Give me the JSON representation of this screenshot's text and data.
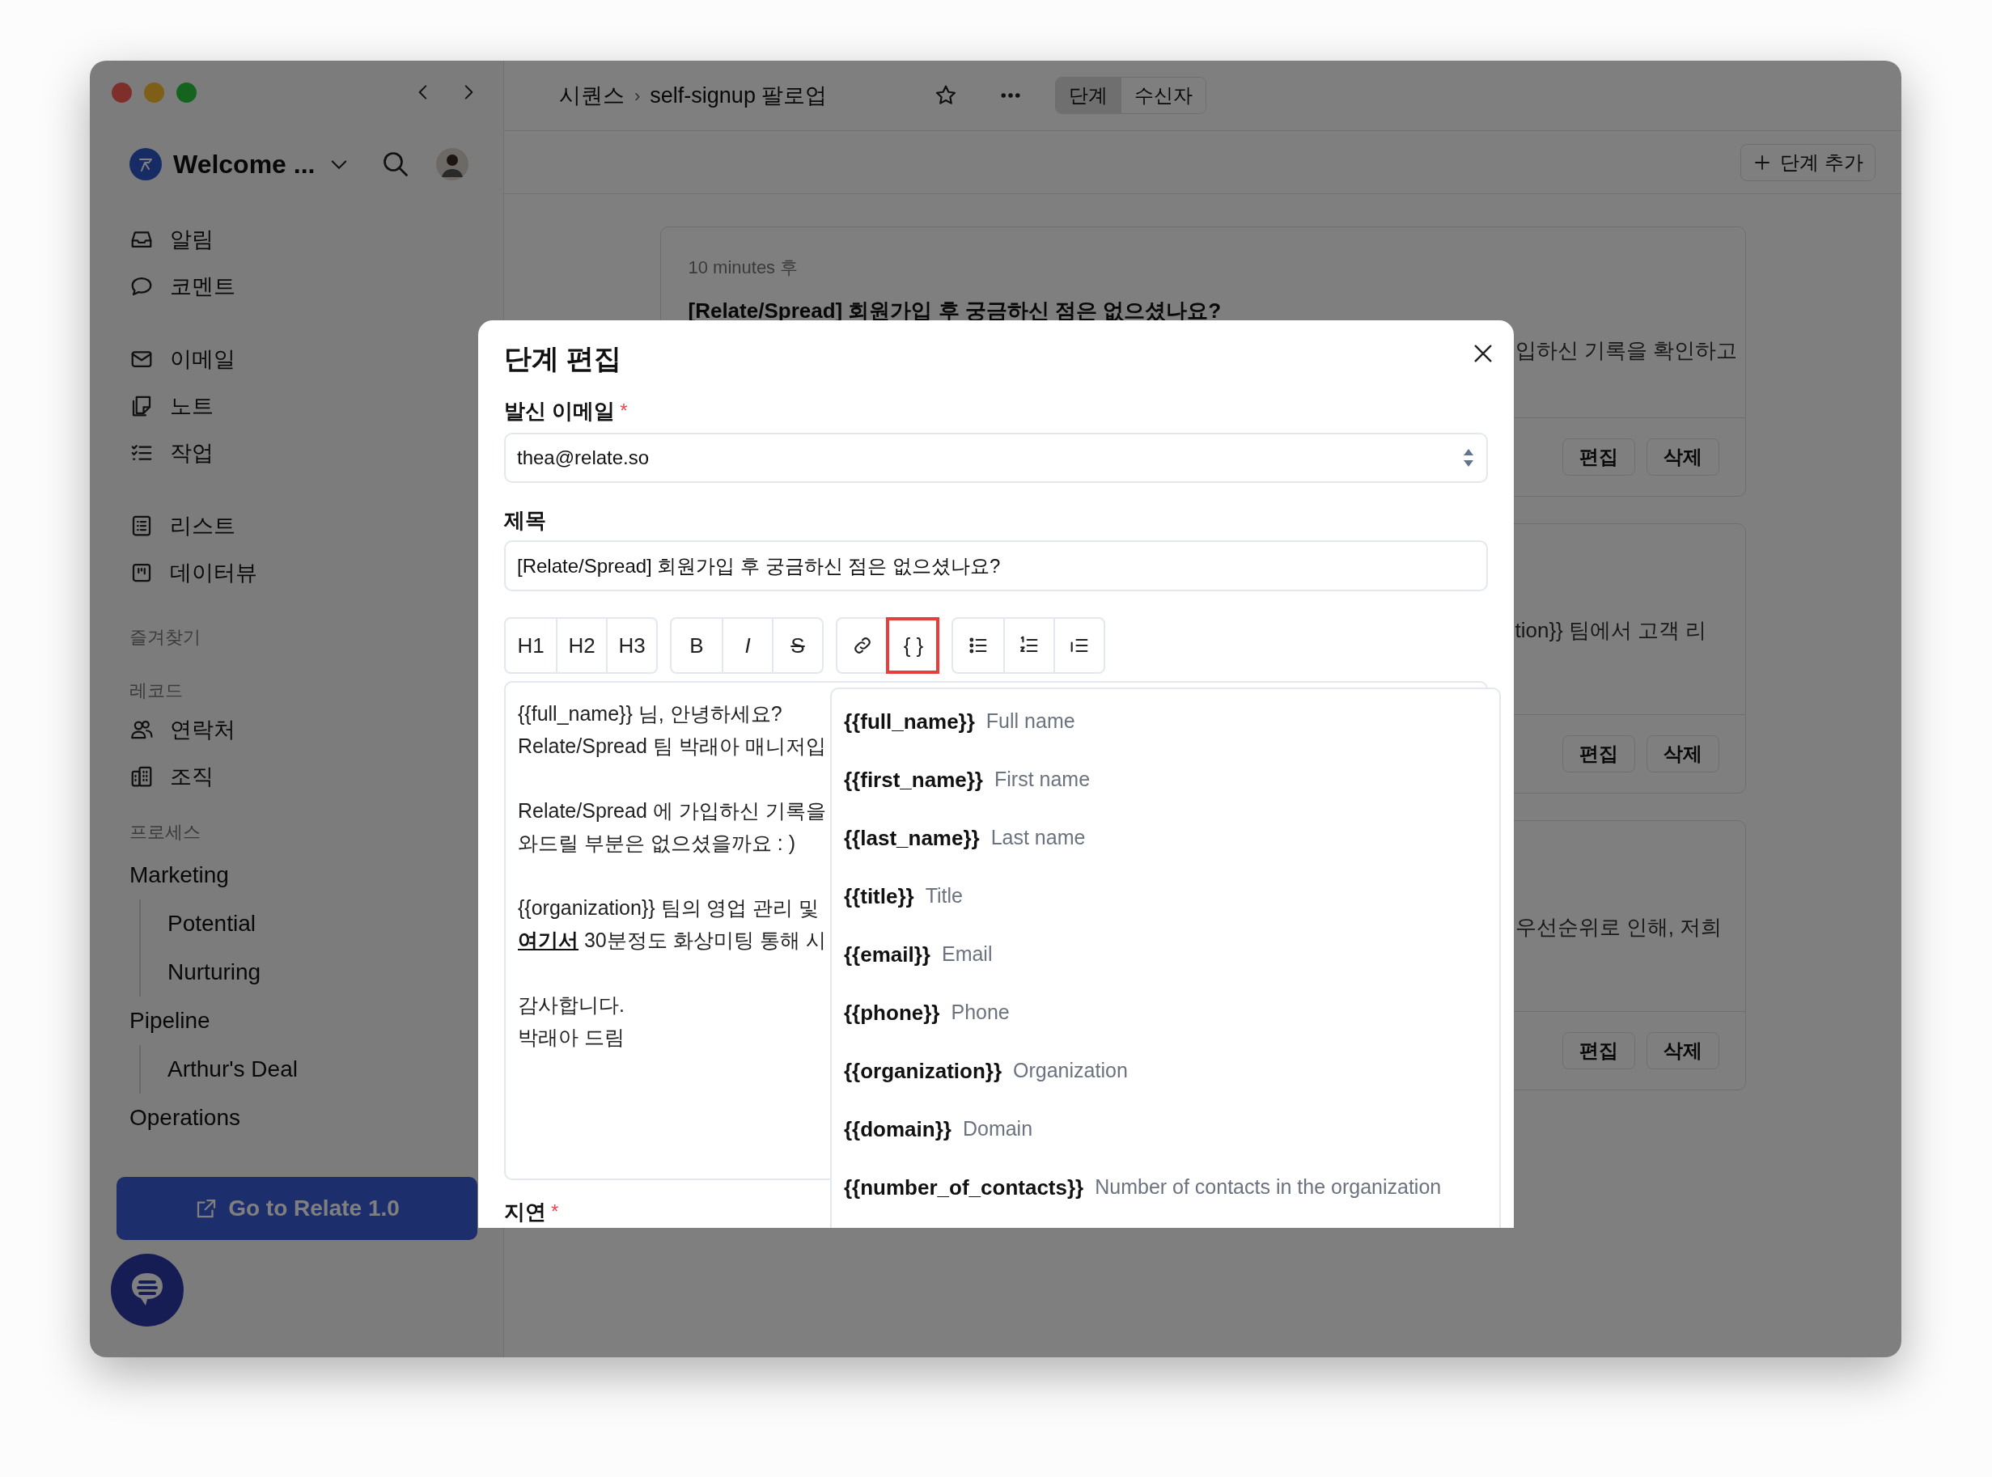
{
  "workspace": {
    "name": "Welcome ..."
  },
  "sidebar": {
    "nav_groups": [
      [
        {
          "label": "알림",
          "kind": "inbox"
        },
        {
          "label": "코멘트",
          "kind": "comment"
        }
      ],
      [
        {
          "label": "이메일",
          "kind": "mail"
        },
        {
          "label": "노트",
          "kind": "note"
        },
        {
          "label": "작업",
          "kind": "tasks"
        }
      ],
      [
        {
          "label": "리스트",
          "kind": "list"
        },
        {
          "label": "데이터뷰",
          "kind": "board"
        }
      ]
    ],
    "favorites": {
      "title": "즐겨찾기"
    },
    "records": {
      "title": "레코드",
      "items": [
        {
          "label": "연락처",
          "kind": "people"
        },
        {
          "label": "조직",
          "kind": "building"
        }
      ]
    },
    "processes": {
      "title": "프로세스",
      "items": [
        {
          "label": "Marketing",
          "children": [
            {
              "label": "Potential"
            },
            {
              "label": "Nurturing"
            }
          ]
        },
        {
          "label": "Pipeline",
          "children": [
            {
              "label": "Arthur's Deal"
            }
          ]
        },
        {
          "label": "Operations"
        }
      ]
    },
    "cta": "Go to Relate 1.0"
  },
  "header": {
    "breadcrumb": [
      "시퀀스",
      "self-signup 팔로업"
    ],
    "separator": "›",
    "tabs": [
      {
        "label": "단계",
        "selected": true
      },
      {
        "label": "수신자",
        "selected": false
      }
    ],
    "add_button": "단계 추가"
  },
  "cards": [
    {
      "delay": "10 minutes 후",
      "title": "[Relate/Spread] 회원가입 후 궁금하신 점은 없으셨나요?",
      "snippet": "입하신 기록을 확인하고",
      "buttons": [
        "편집",
        "삭제"
      ]
    },
    {
      "snippet": "tion}} 팀에서 고객 리",
      "buttons": [
        "편집",
        "삭제"
      ]
    },
    {
      "snippet": "우선순위로 인해, 저희",
      "buttons": [
        "편집",
        "삭제"
      ]
    }
  ],
  "modal": {
    "title": "단계 편집",
    "sender": {
      "label": "발신 이메일",
      "required_mark": "*",
      "value": "thea@relate.so"
    },
    "subject": {
      "label": "제목",
      "value": "[Relate/Spread] 회원가입 후 궁금하신 점은 없으셨나요?"
    },
    "toolbar": [
      [
        {
          "kind": "text",
          "label": "H1",
          "highlighted": false
        },
        {
          "kind": "text",
          "label": "H2",
          "highlighted": false
        },
        {
          "kind": "text",
          "label": "H3",
          "highlighted": false
        }
      ],
      [
        {
          "kind": "bold",
          "label": "B",
          "highlighted": false
        },
        {
          "kind": "italic",
          "label": "I",
          "highlighted": false
        },
        {
          "kind": "strike",
          "label": "S",
          "highlighted": false
        }
      ],
      [
        {
          "kind": "link",
          "highlighted": false
        },
        {
          "kind": "text",
          "label": "{ }",
          "highlighted": true
        }
      ],
      [
        {
          "kind": "bullets",
          "highlighted": false
        },
        {
          "kind": "numbers",
          "highlighted": false
        },
        {
          "kind": "indent",
          "highlighted": false
        }
      ]
    ],
    "body": [
      {
        "lines": [
          {
            "text": "{{full_name}} 님, 안녕하세요?"
          },
          {
            "text": "Relate/Spread 팀 박래아 매니저입"
          }
        ]
      },
      {
        "lines": [
          {
            "text": "Relate/Spread 에 가입하신 기록을"
          },
          {
            "text": "와드릴 부분은 없으셨을까요 : )"
          }
        ]
      },
      {
        "lines": [
          {
            "text": "{{organization}} 팀의 영업 관리 및"
          },
          {
            "link": "여기서",
            "text": " 30분정도 화상미팅 통해 시"
          }
        ]
      },
      {
        "lines": [
          {
            "text": "감사합니다."
          },
          {
            "text": "박래아 드림"
          }
        ]
      }
    ],
    "variables": [
      {
        "token": "{{full_name}}",
        "label": "Full name"
      },
      {
        "token": "{{first_name}}",
        "label": "First name"
      },
      {
        "token": "{{last_name}}",
        "label": "Last name"
      },
      {
        "token": "{{title}}",
        "label": "Title"
      },
      {
        "token": "{{email}}",
        "label": "Email"
      },
      {
        "token": "{{phone}}",
        "label": "Phone"
      },
      {
        "token": "{{organization}}",
        "label": "Organization"
      },
      {
        "token": "{{domain}}",
        "label": "Domain"
      },
      {
        "token": "{{number_of_contacts}}",
        "label": "Number of contacts in the organization"
      }
    ],
    "delay": {
      "label": "지연",
      "required_mark": "*"
    }
  }
}
